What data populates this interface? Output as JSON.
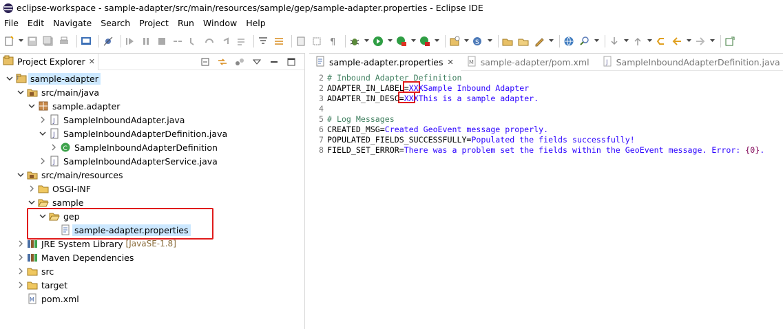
{
  "window": {
    "title": "eclipse-workspace - sample-adapter/src/main/resources/sample/gep/sample-adapter.properties - Eclipse IDE",
    "app_icon": "eclipse-icon"
  },
  "menu": [
    "File",
    "Edit",
    "Navigate",
    "Search",
    "Project",
    "Run",
    "Window",
    "Help"
  ],
  "project_explorer": {
    "title": "Project Explorer",
    "close": "✕",
    "tree": [
      {
        "label": "sample-adapter",
        "icon": "project-icon",
        "twisty": "open",
        "selected": true
      },
      {
        "label": "src/main/java",
        "icon": "source-folder-icon",
        "twisty": "open"
      },
      {
        "label": "sample.adapter",
        "icon": "package-icon",
        "twisty": "open"
      },
      {
        "label": "SampleInboundAdapter.java",
        "icon": "java-file-icon",
        "twisty": "closed"
      },
      {
        "label": "SampleInboundAdapterDefinition.java",
        "icon": "java-file-icon",
        "twisty": "open"
      },
      {
        "label": "SampleInboundAdapterDefinition",
        "icon": "class-icon",
        "twisty": "closed"
      },
      {
        "label": "SampleInboundAdapterService.java",
        "icon": "java-file-icon",
        "twisty": "closed"
      },
      {
        "label": "src/main/resources",
        "icon": "source-folder-icon",
        "twisty": "open"
      },
      {
        "label": "OSGI-INF",
        "icon": "folder-icon",
        "twisty": "closed"
      },
      {
        "label": "sample",
        "icon": "folder-open-icon",
        "twisty": "open"
      },
      {
        "label": "gep",
        "icon": "folder-open-icon",
        "twisty": "open"
      },
      {
        "label": "sample-adapter.properties",
        "icon": "properties-file-icon",
        "twisty": "none",
        "selected": true
      },
      {
        "label": "JRE System Library",
        "icon": "library-icon",
        "twisty": "closed",
        "decor": "[JavaSE-1.8]"
      },
      {
        "label": "Maven Dependencies",
        "icon": "library-icon",
        "twisty": "closed"
      },
      {
        "label": "src",
        "icon": "folder-icon",
        "twisty": "closed"
      },
      {
        "label": "target",
        "icon": "folder-icon",
        "twisty": "closed"
      },
      {
        "label": "pom.xml",
        "icon": "xml-file-icon",
        "twisty": "none"
      }
    ]
  },
  "editor": {
    "tabs": [
      {
        "label": "sample-adapter.properties",
        "active": true,
        "close": "✕",
        "icon": "properties-file-icon"
      },
      {
        "label": "sample-adapter/pom.xml",
        "active": false,
        "icon": "maven-pom-icon"
      },
      {
        "label": "SampleInboundAdapterDefinition.java",
        "active": false,
        "icon": "java-file-icon"
      }
    ],
    "lines": [
      {
        "num": "2",
        "comment": "# Inbound Adapter Definition"
      },
      {
        "num": "2",
        "key": "ADAPTER_IN_LABEL",
        "eq": "=",
        "value": "XXXSample Inbound Adapter"
      },
      {
        "num": "3",
        "key": "ADAPTER_IN_DESC",
        "eq": "=",
        "value": "XXXThis is a sample adapter."
      },
      {
        "num": "4"
      },
      {
        "num": "5",
        "comment": "# Log Messages"
      },
      {
        "num": "6",
        "key": "CREATED_MSG",
        "eq": "=",
        "value": "Created GeoEvent message properly."
      },
      {
        "num": "7",
        "key": "POPULATED_FIELDS_SUCCESSFULLY",
        "eq": "=",
        "value": "Populated the fields successfully!"
      },
      {
        "num": "8",
        "key": "FIELD_SET_ERROR",
        "eq": "=",
        "value": "There was a problem set the fields within the GeoEvent message. Error: ",
        "arg": "{0}",
        "tail": "."
      }
    ]
  },
  "colors": {
    "highlight": "#e01b1b",
    "selection": "#cce8ff",
    "comment": "#3f7f5f",
    "value": "#2a00ff"
  }
}
